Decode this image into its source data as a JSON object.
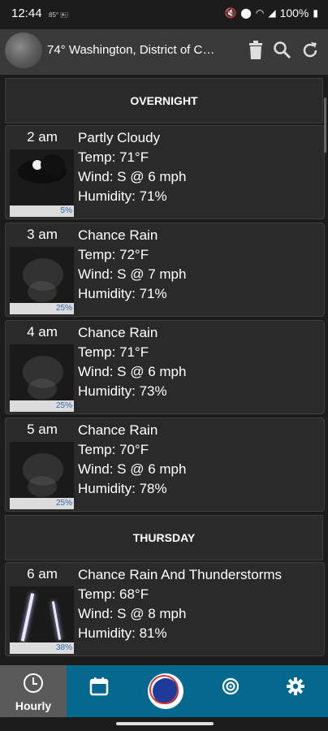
{
  "status_bar": {
    "time": "12:44",
    "mini_icons": "85° 🖭",
    "battery": "100%"
  },
  "header": {
    "location": "74°  Washington, District of C…"
  },
  "sections": [
    {
      "label": "OVERNIGHT"
    },
    {
      "label": "THURSDAY"
    }
  ],
  "forecast": [
    {
      "hour": "2 am",
      "condition": "Partly Cloudy",
      "temp": "Temp: 71°F",
      "wind": "Wind: S @ 6 mph",
      "humidity": "Humidity: 71%",
      "precip": "5%",
      "icon": "partly-cloudy-night"
    },
    {
      "hour": "3 am",
      "condition": "Chance Rain",
      "temp": "Temp: 72°F",
      "wind": "Wind: S @ 7 mph",
      "humidity": "Humidity: 71%",
      "precip": "25%",
      "icon": "rain"
    },
    {
      "hour": "4 am",
      "condition": "Chance Rain",
      "temp": "Temp: 71°F",
      "wind": "Wind: S @ 6 mph",
      "humidity": "Humidity: 73%",
      "precip": "25%",
      "icon": "rain"
    },
    {
      "hour": "5 am",
      "condition": "Chance Rain",
      "temp": "Temp: 70°F",
      "wind": "Wind: S @ 6 mph",
      "humidity": "Humidity: 78%",
      "precip": "25%",
      "icon": "rain"
    },
    {
      "hour": "6 am",
      "condition": "Chance Rain And Thunderstorms",
      "temp": "Temp: 68°F",
      "wind": "Wind: S @ 8 mph",
      "humidity": "Humidity: 81%",
      "precip": "38%",
      "icon": "thunderstorm"
    }
  ],
  "nav": {
    "hourly_label": "Hourly"
  },
  "colors": {
    "nav_background": "#05698f",
    "card_background": "#2a2a2a",
    "header_background": "#3a3a3a"
  }
}
